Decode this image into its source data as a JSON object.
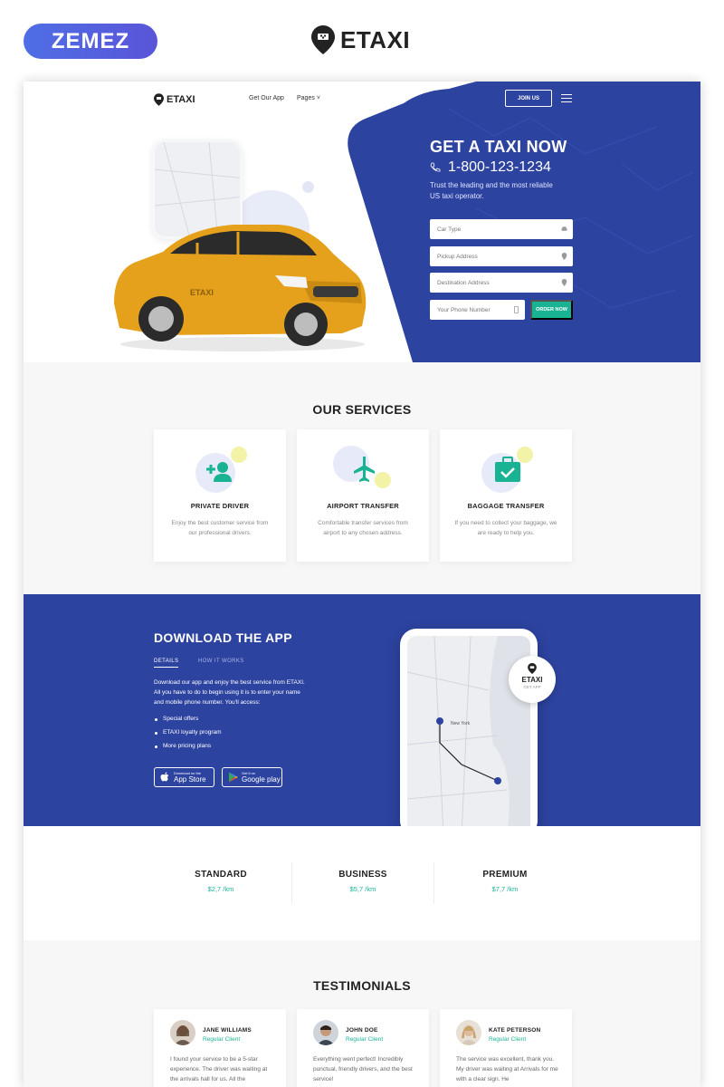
{
  "top": {
    "marketplace": "ZEMEZ",
    "brand": "ETAXI"
  },
  "nav": {
    "logo": "ETAXI",
    "links": [
      "Get Our App",
      "Pages"
    ],
    "join": "JOIN US"
  },
  "hero": {
    "title": "GET A TAXI NOW",
    "phone": "1-800-123-1234",
    "subtitle": "Trust the leading and the most reliable US taxi operator.",
    "fields": {
      "car_type": "Car Type",
      "pickup": "Pickup Address",
      "destination": "Destination Address",
      "phone": "Your Phone Number"
    },
    "order": "ORDER NOW",
    "car_label": "ETAXI"
  },
  "services": {
    "title": "OUR SERVICES",
    "items": [
      {
        "title": "PRIVATE DRIVER",
        "desc": "Enjoy the best customer service from our professional drivers.",
        "icon": "add-user-icon"
      },
      {
        "title": "AIRPORT TRANSFER",
        "desc": "Comfortable transfer services from airport to any chosen address.",
        "icon": "airplane-icon"
      },
      {
        "title": "BAGGAGE TRANSFER",
        "desc": "If you need to collect your baggage, we are ready to help you.",
        "icon": "suitcase-check-icon"
      }
    ]
  },
  "download": {
    "title": "DOWNLOAD THE APP",
    "tabs": [
      "DETAILS",
      "HOW IT WORKS"
    ],
    "text": "Download our app and enjoy the best service from ETAXI. All you have to do to begin using it is to enter your name and mobile phone number. You'll access:",
    "list": [
      "Special offers",
      "ETAXI loyalty program",
      "More pricing plans"
    ],
    "app_store": {
      "small": "Download on the",
      "big": "App Store"
    },
    "google_play": {
      "small": "Get it on",
      "big": "Google play"
    },
    "badge": {
      "name": "ETAXI",
      "sub": "GET APP"
    },
    "map_labels": [
      "New York"
    ]
  },
  "pricing": {
    "plans": [
      {
        "name": "STANDARD",
        "price": "$2,7 /km"
      },
      {
        "name": "BUSINESS",
        "price": "$5,7 /km"
      },
      {
        "name": "PREMIUM",
        "price": "$7,7 /km"
      }
    ]
  },
  "testimonials": {
    "title": "TESTIMONIALS",
    "items": [
      {
        "name": "JANE WILLIAMS",
        "role": "Regular Client",
        "quote": "I found your service to be a 5-star experience. The driver was waiting at the arrivals hall for us. All the"
      },
      {
        "name": "JOHN DOE",
        "role": "Regular Client",
        "quote": "Everything went perfect! Incredibly punctual, friendly drivers, and the best service!"
      },
      {
        "name": "KATE PETERSON",
        "role": "Regular Client",
        "quote": "The service was excellent, thank you. My driver was waiting at Arrivals for me with a clear sign. He"
      }
    ]
  },
  "colors": {
    "blue": "#2d43a0",
    "accent": "#19b394",
    "car": "#e6a11c"
  }
}
